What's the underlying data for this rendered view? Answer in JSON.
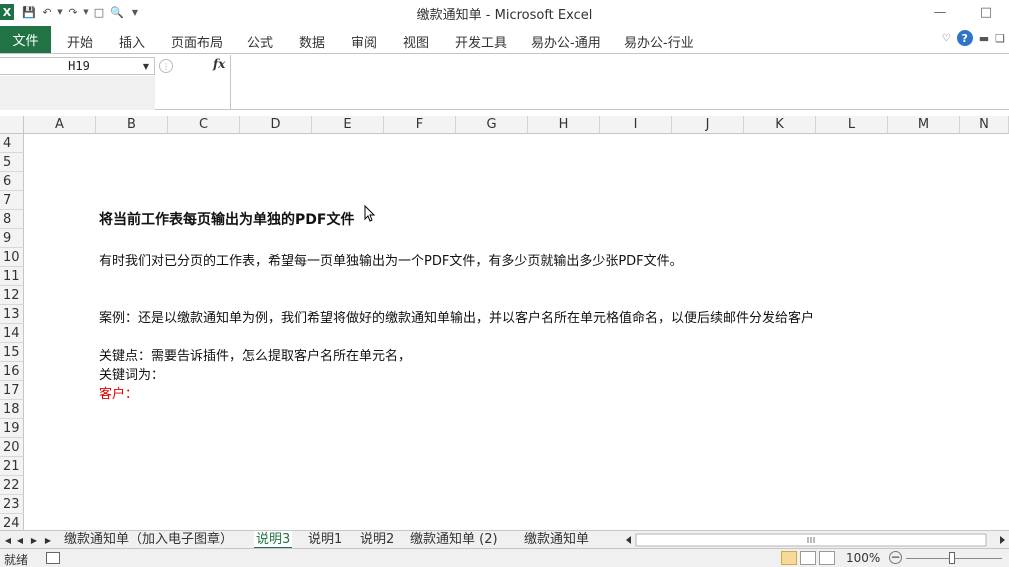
{
  "window": {
    "title": "缴款通知单 - Microsoft Excel"
  },
  "ribbon": {
    "tabs": [
      "文件",
      "开始",
      "插入",
      "页面布局",
      "公式",
      "数据",
      "审阅",
      "视图",
      "开发工具",
      "易办公-通用",
      "易办公-行业"
    ]
  },
  "formula_bar": {
    "name_box": "H19",
    "fx_label": "fx",
    "content": ""
  },
  "grid": {
    "columns": [
      "A",
      "B",
      "C",
      "D",
      "E",
      "F",
      "G",
      "H",
      "I",
      "J",
      "K",
      "L",
      "M",
      "N"
    ],
    "rows": [
      "4",
      "5",
      "6",
      "7",
      "8",
      "9",
      "10",
      "11",
      "12",
      "13",
      "14",
      "15",
      "16",
      "17",
      "18",
      "19",
      "20",
      "21",
      "22",
      "23",
      "24"
    ],
    "cells": {
      "row7": "将当前工作表每页输出为单独的PDF文件",
      "row9": "有时我们对已分页的工作表，希望每一页单独输出为一个PDF文件，有多少页就输出多少张PDF文件。",
      "row12": "案例：还是以缴款通知单为例，我们希望将做好的缴款通知单输出，并以客户名所在单元格值命名，以便后续邮件分发给客户",
      "row14": "关键点：需要告诉插件，怎么提取客户名所在单元名，",
      "row15": "关键词为：",
      "row16": "客户："
    }
  },
  "sheet_tabs": [
    "缴款通知单（加入电子图章）",
    "说明3",
    "说明1",
    "说明2",
    "缴款通知单 (2)",
    "缴款通知单"
  ],
  "active_sheet": "说明3",
  "status": {
    "ready": "就绪",
    "zoom": "100%"
  },
  "colors": {
    "file_tab": "#217346",
    "red_text": "#e00000"
  }
}
